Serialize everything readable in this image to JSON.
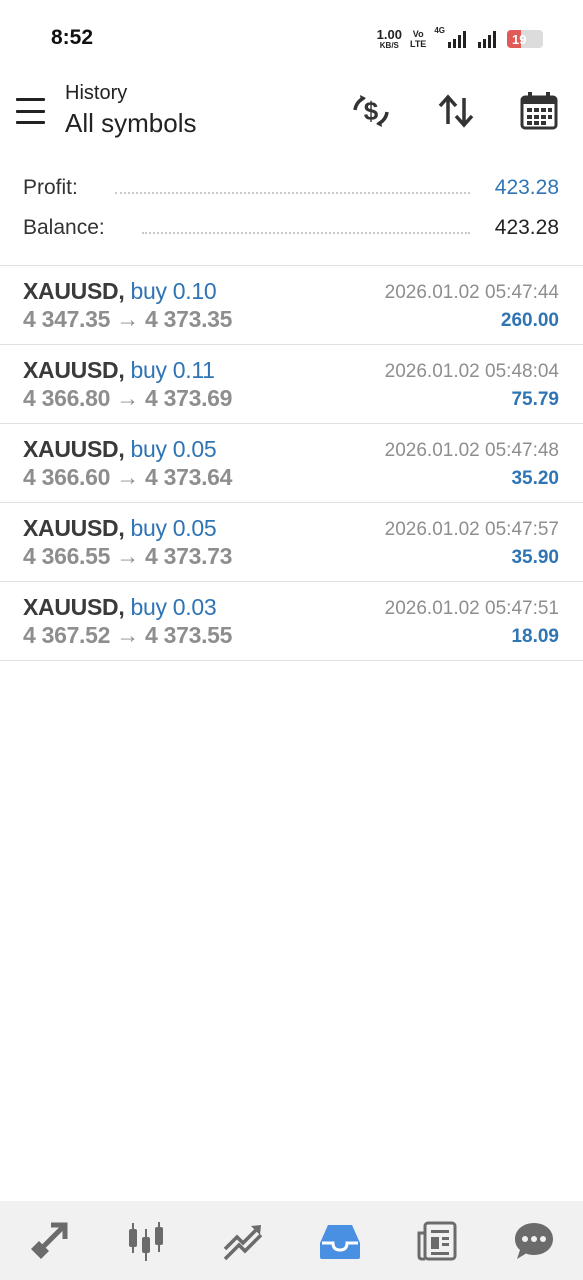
{
  "status_bar": {
    "time": "8:52",
    "net_speed": "1.00",
    "net_unit": "KB/S",
    "volte_top": "Vo",
    "volte_bottom": "LTE",
    "signal_tag": "4G",
    "battery": "19",
    "battery_color": "#e15a57"
  },
  "header": {
    "subtitle": "History",
    "title": "All symbols",
    "icons": [
      "currency-exchange-icon",
      "sort-icon",
      "calendar-icon"
    ]
  },
  "summary": {
    "profit_label": "Profit:",
    "profit_value": "423.28",
    "balance_label": "Balance:",
    "balance_value": "423.28"
  },
  "colors": {
    "accent_blue": "#2f74b5",
    "price_gray": "#8e8e8e",
    "nav_active": "#4a90e2",
    "nav_inactive": "#6b6b6b"
  },
  "deals": [
    {
      "symbol": "XAUUSD,",
      "type": "buy 0.10",
      "open": "4 347.35",
      "close": "4 373.35",
      "time": "2026.01.02 05:47:44",
      "profit": "260.00"
    },
    {
      "symbol": "XAUUSD,",
      "type": "buy 0.11",
      "open": "4 366.80",
      "close": "4 373.69",
      "time": "2026.01.02 05:48:04",
      "profit": "75.79"
    },
    {
      "symbol": "XAUUSD,",
      "type": "buy 0.05",
      "open": "4 366.60",
      "close": "4 373.64",
      "time": "2026.01.02 05:47:48",
      "profit": "35.20"
    },
    {
      "symbol": "XAUUSD,",
      "type": "buy 0.05",
      "open": "4 366.55",
      "close": "4 373.73",
      "time": "2026.01.02 05:47:57",
      "profit": "35.90"
    },
    {
      "symbol": "XAUUSD,",
      "type": "buy 0.03",
      "open": "4 367.52",
      "close": "4 373.55",
      "time": "2026.01.02 05:47:51",
      "profit": "18.09"
    }
  ],
  "price_arrow": "→",
  "bottom_nav": {
    "items": [
      "quotes-icon",
      "chart-icon",
      "trade-icon",
      "history-icon",
      "news-icon",
      "chat-icon"
    ],
    "active": "history-icon"
  }
}
